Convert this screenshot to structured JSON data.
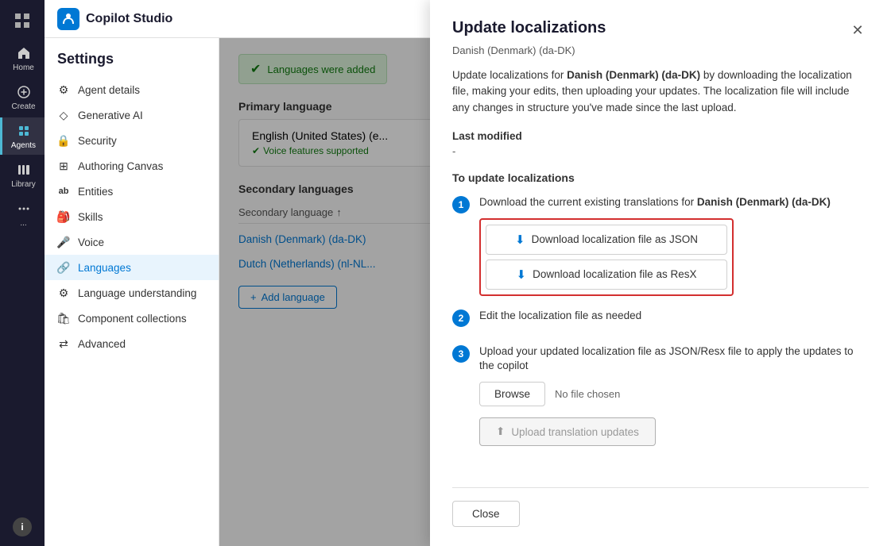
{
  "app": {
    "name": "Copilot Studio"
  },
  "nav": {
    "items": [
      {
        "id": "home",
        "label": "Home",
        "active": false
      },
      {
        "id": "create",
        "label": "Create",
        "active": false
      },
      {
        "id": "agents",
        "label": "Agents",
        "active": true
      },
      {
        "id": "library",
        "label": "Library",
        "active": false
      },
      {
        "id": "more",
        "label": "...",
        "active": false
      }
    ],
    "info_label": "i"
  },
  "settings": {
    "title": "Settings",
    "sidebar_items": [
      {
        "id": "agent-details",
        "label": "Agent details",
        "icon": "⚙"
      },
      {
        "id": "generative-ai",
        "label": "Generative AI",
        "icon": "◇"
      },
      {
        "id": "security",
        "label": "Security",
        "icon": "🔒"
      },
      {
        "id": "authoring-canvas",
        "label": "Authoring Canvas",
        "icon": "⊞"
      },
      {
        "id": "entities",
        "label": "Entities",
        "icon": "ab"
      },
      {
        "id": "skills",
        "label": "Skills",
        "icon": "🎒"
      },
      {
        "id": "voice",
        "label": "Voice",
        "icon": "🎤"
      },
      {
        "id": "languages",
        "label": "Languages",
        "icon": "🔗",
        "active": true
      },
      {
        "id": "language-understanding",
        "label": "Language understanding",
        "icon": "⚙"
      },
      {
        "id": "component-collections",
        "label": "Component collections",
        "icon": "🛍"
      },
      {
        "id": "advanced",
        "label": "Advanced",
        "icon": "⇄"
      }
    ]
  },
  "notification": {
    "text": "Languages were added"
  },
  "primary_language": {
    "section_title": "Primary language",
    "language_name": "English (United States) (e...",
    "voice_text": "Voice features supported"
  },
  "secondary_languages": {
    "section_title": "Secondary languages",
    "column_header": "Secondary language",
    "sort_icon": "↑",
    "items": [
      {
        "name": "Danish (Denmark) (da-DK)"
      },
      {
        "name": "Dutch (Netherlands) (nl-NL..."
      }
    ],
    "add_button": "Add language"
  },
  "modal": {
    "title": "Update localizations",
    "subtitle": "Danish (Denmark) (da-DK)",
    "description_parts": [
      "Update localizations for ",
      "Danish (Denmark) (da-DK)",
      " by downloading the localization file, making your edits, then uploading your updates. The localization file will include any changes in structure you've made since the last upload."
    ],
    "description_full": "Update localizations for Danish (Denmark) (da-DK) by downloading the localization file, making your edits, then uploading your updates. The localization file will include any changes in structure you've made since the last upload.",
    "last_modified_label": "Last modified",
    "last_modified_value": "-",
    "to_update_title": "To update localizations",
    "steps": [
      {
        "number": "1",
        "text_parts": [
          "Download the current existing translations for ",
          "Danish (Denmark) (da-DK)"
        ],
        "buttons": [
          {
            "id": "download-json",
            "label": "Download localization file as JSON"
          },
          {
            "id": "download-resx",
            "label": "Download localization file as ResX"
          }
        ]
      },
      {
        "number": "2",
        "text": "Edit the localization file as needed",
        "buttons": []
      },
      {
        "number": "3",
        "text": "Upload your updated localization file as JSON/Resx file to apply the updates to the copilot",
        "browse_label": "Browse",
        "no_file_label": "No file chosen",
        "upload_label": "Upload translation updates"
      }
    ],
    "close_label": "Close"
  }
}
